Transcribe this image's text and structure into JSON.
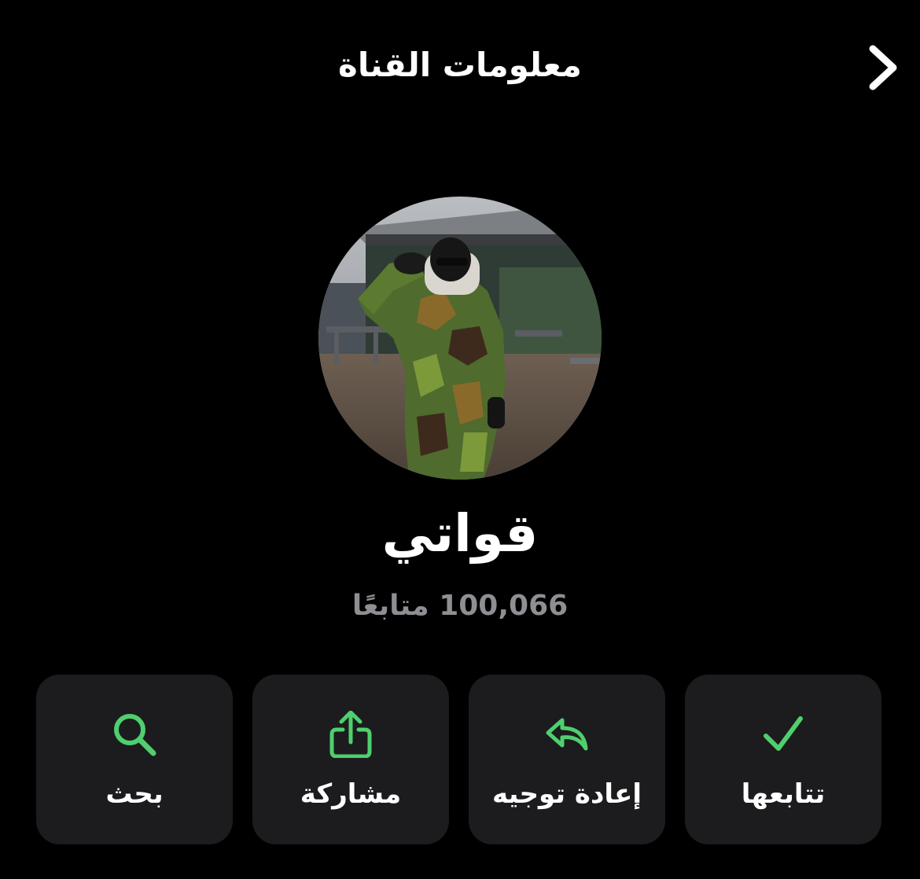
{
  "header": {
    "title": "معلومات القناة",
    "back_icon": "chevron-right-icon"
  },
  "channel": {
    "name": "قواتي",
    "followers_text": "100,066 متابعًا",
    "avatar": "person-in-camouflage-saluting-photo"
  },
  "actions": [
    {
      "label": "تتابعها",
      "icon": "checkmark-icon"
    },
    {
      "label": "إعادة توجيه",
      "icon": "forward-arrow-icon"
    },
    {
      "label": "مشاركة",
      "icon": "share-icon"
    },
    {
      "label": "بحث",
      "icon": "search-icon"
    }
  ],
  "colors": {
    "background": "#000000",
    "card": "#1c1c1e",
    "accent": "#4fcf6e",
    "secondary_text": "#8e8e93"
  }
}
